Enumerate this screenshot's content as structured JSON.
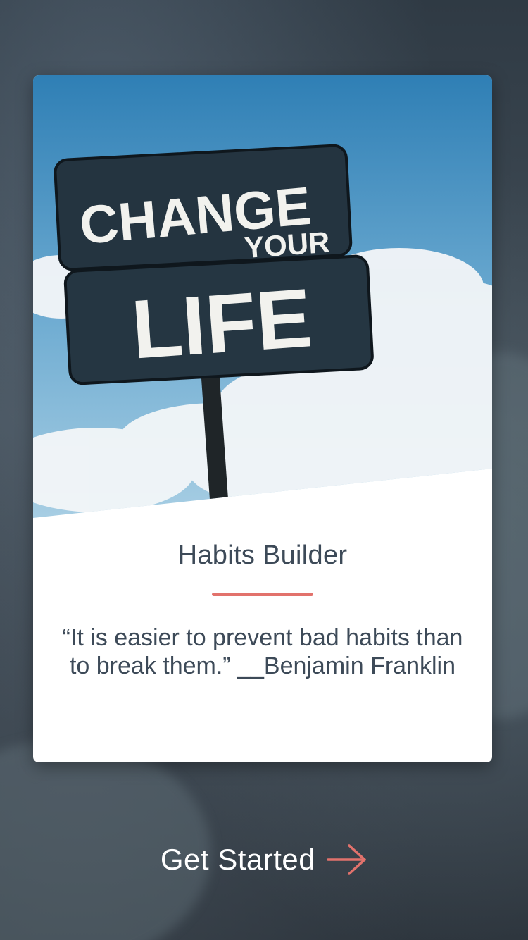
{
  "hero": {
    "sign_line_1": "CHANGE",
    "sign_line_2": "YOUR",
    "sign_line_3": "LIFE"
  },
  "card": {
    "title": "Habits Builder",
    "quote": "“It is easier to prevent bad habits than to break them.” __Benjamin Franklin"
  },
  "cta": {
    "label": "Get Started",
    "icon": "arrow-right-icon"
  },
  "colors": {
    "accent": "#e2726c",
    "text": "#3d4a58",
    "background": "#3a4550"
  }
}
